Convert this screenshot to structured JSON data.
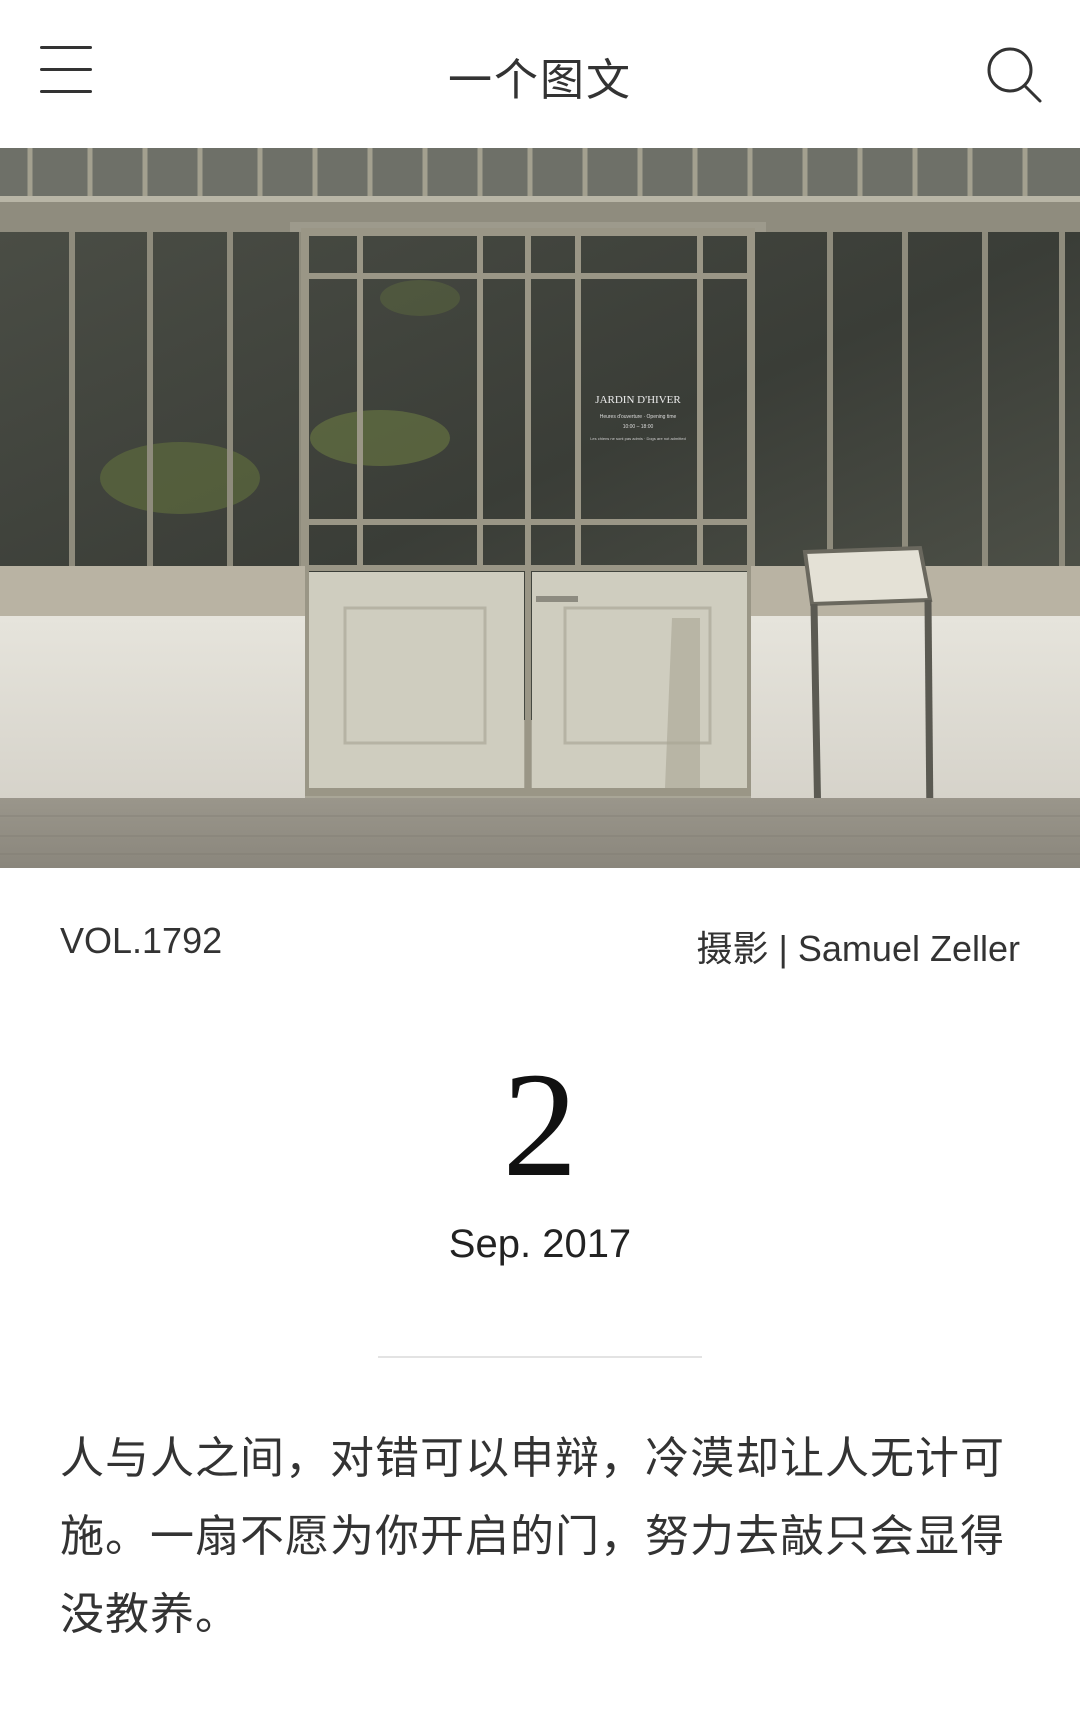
{
  "header": {
    "title": "一个图文",
    "menu_icon": "hamburger-menu-icon",
    "search_icon": "search-icon"
  },
  "photo": {
    "sign_title": "JARDIN D'HIVER",
    "sign_line1": "Heures d'ouverture · Opening time",
    "sign_line2": "10:00 – 18:00",
    "sign_line3": "Les chiens ne sont pas admis · Dogs are not admitted"
  },
  "meta": {
    "vol": "VOL.1792",
    "credit": "摄影 | Samuel Zeller"
  },
  "date": {
    "day": "2",
    "month_year": "Sep. 2017"
  },
  "quote": {
    "text": "人与人之间，对错可以申辩，冷漠却让人无计可施。一扇不愿为你开启的门，努力去敲只会显得没教养。"
  }
}
